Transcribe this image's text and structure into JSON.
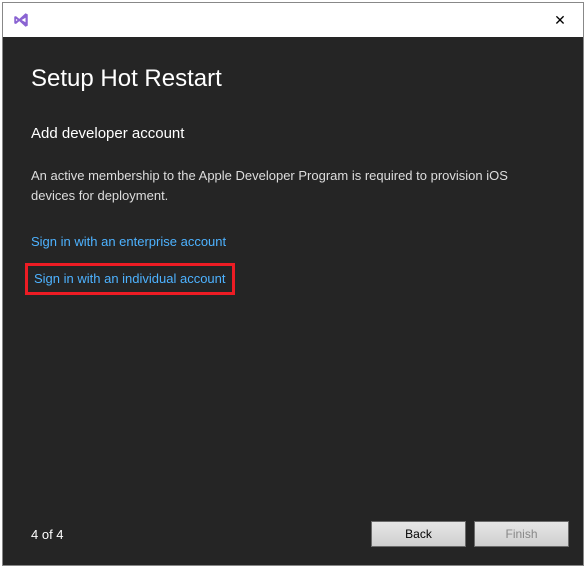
{
  "titlebar": {
    "close_glyph": "✕"
  },
  "content": {
    "title": "Setup Hot Restart",
    "subtitle": "Add developer account",
    "description": "An active membership to the Apple Developer Program is required to provision iOS devices for deployment.",
    "link_enterprise": "Sign in with an enterprise account",
    "link_individual": "Sign in with an individual account"
  },
  "footer": {
    "page_indicator": "4 of 4",
    "back_label": "Back",
    "finish_label": "Finish"
  }
}
